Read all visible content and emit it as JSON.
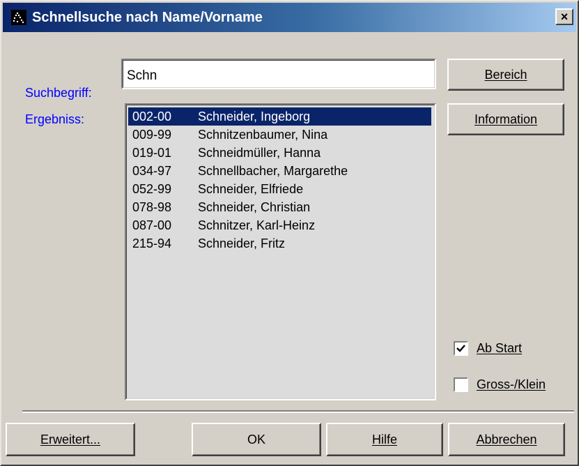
{
  "window": {
    "title": "Schnellsuche nach Name/Vorname",
    "close_label": "×",
    "app_icon": "dotted-figure-icon"
  },
  "search": {
    "label": "Suchbegriff:",
    "value": "Schn"
  },
  "results": {
    "label": "Ergebniss:",
    "items": [
      {
        "code": "002-00",
        "name": "Schneider, Ingeborg",
        "selected": true
      },
      {
        "code": "009-99",
        "name": "Schnitzenbaumer, Nina",
        "selected": false
      },
      {
        "code": "019-01",
        "name": "Schneidmüller, Hanna",
        "selected": false
      },
      {
        "code": "034-97",
        "name": "Schnellbacher, Margarethe",
        "selected": false
      },
      {
        "code": "052-99",
        "name": "Schneider, Elfriede",
        "selected": false
      },
      {
        "code": "078-98",
        "name": "Schneider, Christian",
        "selected": false
      },
      {
        "code": "087-00",
        "name": "Schnitzer, Karl-Heinz",
        "selected": false
      },
      {
        "code": "215-94",
        "name": "Schneider, Fritz",
        "selected": false
      }
    ]
  },
  "buttons": {
    "bereich": "Bereich",
    "information": "Information",
    "erweitert": "Erweitert...",
    "ok": "OK",
    "hilfe": "Hilfe",
    "abbrechen": "Abbrechen"
  },
  "options": {
    "ab_start": {
      "label": "Ab Start",
      "checked": true
    },
    "gross_klein": {
      "label": "Gross-/Klein",
      "checked": false
    }
  },
  "colors": {
    "label_blue": "#0000ff",
    "selection": "#0a246a",
    "titlebar_start": "#0a246a",
    "titlebar_end": "#a6caf0",
    "dialog_face": "#d4d0c8"
  }
}
